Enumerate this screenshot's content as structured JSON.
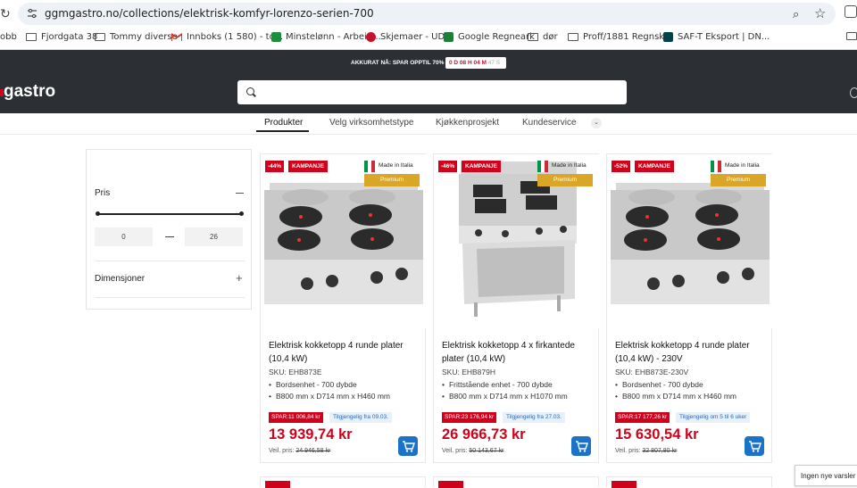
{
  "browser": {
    "url": "ggmgastro.no/collections/elektrisk-komfyr-lorenzo-serien-700",
    "icons": [
      "reload-icon",
      "site-info-icon",
      "zoom-icon",
      "star-icon",
      "extensions-icon"
    ]
  },
  "bookmarks": [
    {
      "label": "obb",
      "icon": "none"
    },
    {
      "label": "Fjordgata 38",
      "icon": "folder-icon"
    },
    {
      "label": "Tommy diverse",
      "icon": "folder-icon"
    },
    {
      "label": "Innboks (1 580) - to...",
      "icon": "gmail-icon"
    },
    {
      "label": "Minstelønn - Arbeid...",
      "icon": "arbeidstilsynet-icon"
    },
    {
      "label": "Skjemaer - UDI",
      "icon": "udi-icon"
    },
    {
      "label": "Google Regneark",
      "icon": "sheets-icon"
    },
    {
      "label": "dør",
      "icon": "folder-icon"
    },
    {
      "label": "Proff/1881 Regnsk...",
      "icon": "folder-icon"
    },
    {
      "label": "SAF-T Eksport | DN...",
      "icon": "dnb-icon"
    }
  ],
  "promo": {
    "text": "AKKURAT NÅ: SPAR OPPTIL 70%",
    "timer": "0 D 08 H 04 M",
    "timer_seconds": "47 S"
  },
  "header": {
    "logo": "gastro",
    "search_placeholder": ""
  },
  "nav": {
    "items": [
      "Produkter",
      "Velg virksomhetstype",
      "Kjøkkenprosjekt",
      "Kundeservice"
    ],
    "active": "Produkter"
  },
  "filters": {
    "price_title": "Pris",
    "price_min": "0",
    "price_max": "26",
    "dimensions_title": "Dimensjoner"
  },
  "products": [
    {
      "discount": "-44%",
      "campaign": "KAMPANJE",
      "made_in": "Made in Italia",
      "premium": "Premium",
      "title": "Elektrisk kokketopp 4 runde plater (10,4 kW)",
      "sku": "SKU: EHB873E",
      "bullets": [
        "Bordsenhet - 700 dybde",
        "B800 mm x D714 mm x H460 mm"
      ],
      "spar": "SPAR:11 006,84 kr",
      "availability": "Tilgjengelig fra 09.03.",
      "price": "13 939,74 kr",
      "old_price_label": "Veil. pris:",
      "old_price": "24 946,58 kr"
    },
    {
      "discount": "-46%",
      "campaign": "KAMPANJE",
      "made_in": "Made in Italia",
      "premium": "Premium",
      "title": "Elektrisk kokketopp 4 x firkantede plater (10,4 kW)",
      "sku": "SKU: EHB879H",
      "bullets": [
        "Frittstående enhet - 700 dybde",
        "B800 mm x D714 mm x H1070 mm"
      ],
      "spar": "SPAR:23 176,94 kr",
      "availability": "Tilgjengelig fra 27.03.",
      "price": "26 966,73 kr",
      "old_price_label": "Veil. pris:",
      "old_price": "50 143,67 kr"
    },
    {
      "discount": "-52%",
      "campaign": "KAMPANJE",
      "made_in": "Made in Italia",
      "premium": "Premium",
      "title": "Elektrisk kokketopp 4 runde plater (10,4 kW) - 230V",
      "sku": "SKU: EHB873E-230V",
      "bullets": [
        "Bordsenhet - 700 dybde",
        "B800 mm x D714 mm x H460 mm"
      ],
      "spar": "SPAR:17 177,26 kr",
      "availability": "Tilgjengelig om 5 til 6 uker",
      "price": "15 630,54 kr",
      "old_price_label": "Veil. pris:",
      "old_price": "32 807,80 kr"
    }
  ],
  "toast": "Ingen nye varsler",
  "colors": {
    "brand_red": "#d0021b",
    "header_dark": "#2c2f33",
    "premium_gold": "#d9a628",
    "cart_blue": "#1a73c9"
  }
}
